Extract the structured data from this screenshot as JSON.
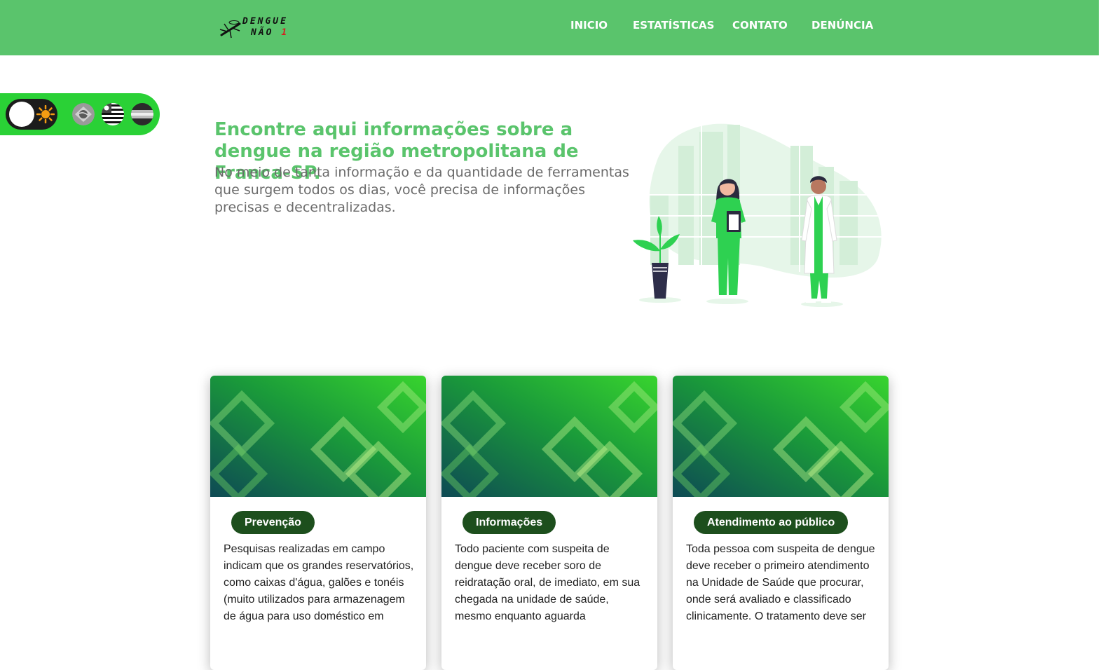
{
  "header": {
    "logo": {
      "line1": "DENGUE",
      "line2": "NÃO",
      "mark": "1",
      "icon": "mosquito-icon"
    },
    "nav": [
      "INICIO",
      "ESTATÍSTICAS",
      "CONTATO",
      "DENÚNCIA"
    ]
  },
  "accessibility": {
    "theme_toggle_icon": "sun-icon",
    "flags": [
      "brazil-flag-icon",
      "sao-paulo-flag-icon",
      "franca-flag-icon"
    ]
  },
  "hero": {
    "title": "Encontre aqui informações sobre a dengue na região metropolitana de Franca-SP.",
    "text": "No meio de tanta informação e da quantidade de ferramentas que surgem todos os dias, você precisa de informações precisas e decentralizadas.",
    "illustration": "health-professionals-illustration"
  },
  "cards": [
    {
      "title": "Prevenção",
      "text": "Pesquisas realizadas em campo indicam que os grandes reservatórios, como caixas d'água, galões e tonéis (muito utilizados para armazenagem de água para uso doméstico em"
    },
    {
      "title": "Informações",
      "text": "Todo paciente com suspeita de dengue deve receber soro de reidratação oral, de imediato, em sua chegada na unidade de saúde, mesmo enquanto aguarda"
    },
    {
      "title": "Atendimento ao público",
      "text": "Toda pessoa com suspeita de dengue deve receber o primeiro atendimento na Unidade de Saúde que procurar, onde será avaliado e classificado clinicamente. O tratamento deve ser"
    }
  ],
  "colors": {
    "brand_green": "#5ac46c",
    "bright_green": "#2ad136",
    "badge_green": "#1d4f1d",
    "hero_title": "#5ac46c",
    "hero_text": "#6b6b6b"
  }
}
